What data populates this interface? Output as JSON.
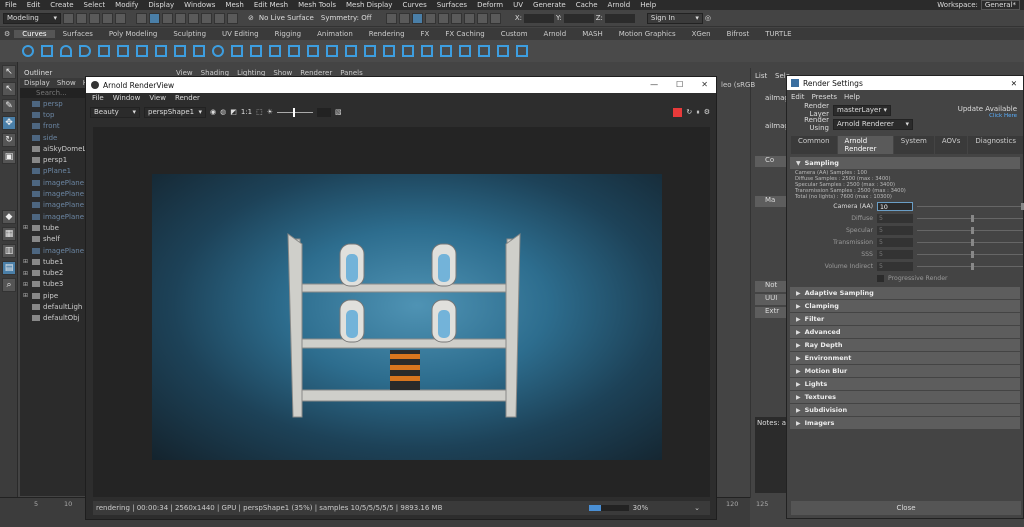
{
  "menubar": {
    "items": [
      "File",
      "Edit",
      "Create",
      "Select",
      "Modify",
      "Display",
      "Windows",
      "Mesh",
      "Edit Mesh",
      "Mesh Tools",
      "Mesh Display",
      "Curves",
      "Surfaces",
      "Deform",
      "UV",
      "Generate",
      "Cache",
      "Arnold",
      "Help"
    ],
    "workspace_label": "Workspace:",
    "workspace_value": "General*"
  },
  "status_line": {
    "mode": "Modeling",
    "live_surface": "No Live Surface",
    "symmetry": "Symmetry: Off",
    "x_label": "X:",
    "y_label": "Y:",
    "z_label": "Z:",
    "sign_in": "Sign In"
  },
  "shelf_tabs": [
    "Curves",
    "Surfaces",
    "Poly Modeling",
    "Sculpting",
    "UV Editing",
    "Rigging",
    "Animation",
    "Rendering",
    "FX",
    "FX Caching",
    "Custom",
    "Arnold",
    "MASH",
    "Motion Graphics",
    "XGen",
    "Bifrost",
    "TURTLE"
  ],
  "outliner": {
    "title": "Outliner",
    "menu": [
      "Display",
      "Show",
      "H"
    ],
    "search_placeholder": "Search...",
    "items": [
      {
        "label": "persp",
        "dim": true,
        "exp": ""
      },
      {
        "label": "top",
        "dim": true,
        "exp": ""
      },
      {
        "label": "front",
        "dim": true,
        "exp": ""
      },
      {
        "label": "side",
        "dim": true,
        "exp": ""
      },
      {
        "label": "aiSkyDomeL",
        "dim": false,
        "exp": ""
      },
      {
        "label": "persp1",
        "dim": false,
        "exp": ""
      },
      {
        "label": "pPlane1",
        "dim": true,
        "exp": ""
      },
      {
        "label": "imagePlane",
        "dim": true,
        "exp": ""
      },
      {
        "label": "imagePlane",
        "dim": true,
        "exp": ""
      },
      {
        "label": "imagePlane",
        "dim": true,
        "exp": ""
      },
      {
        "label": "imagePlane",
        "dim": true,
        "exp": ""
      },
      {
        "label": "tube",
        "dim": false,
        "exp": "+"
      },
      {
        "label": "shelf",
        "dim": false,
        "exp": ""
      },
      {
        "label": "imagePlane",
        "dim": true,
        "exp": ""
      },
      {
        "label": "tube1",
        "dim": false,
        "exp": "+"
      },
      {
        "label": "tube2",
        "dim": false,
        "exp": "+"
      },
      {
        "label": "tube3",
        "dim": false,
        "exp": "+"
      },
      {
        "label": "pipe",
        "dim": false,
        "exp": "+"
      },
      {
        "label": "defaultLigh",
        "dim": false,
        "exp": ""
      },
      {
        "label": "defaultObj",
        "dim": false,
        "exp": ""
      }
    ]
  },
  "viewport_menu": [
    "View",
    "Shading",
    "Lighting",
    "Show",
    "Renderer",
    "Panels"
  ],
  "renderview": {
    "title": "Arnold RenderView",
    "menu": [
      "File",
      "Window",
      "View",
      "Render"
    ],
    "aov": "Beauty",
    "camera": "perspShape1",
    "ratio": "1:1",
    "status": "rendering | 00:00:34 | 2560x1440 | GPU | perspShape1 (35%) | samples 10/5/5/5/5/5 | 9893.16 MB",
    "progress_text": "30%",
    "progress": 0.3
  },
  "attr_editor": {
    "tabs": [
      "List",
      "Sele"
    ],
    "fields": [
      "aiImagerl",
      "aiImag"
    ],
    "labels": [
      "Co",
      "Ma",
      "Not",
      "UUI",
      "Extr"
    ],
    "notes": "Notes: ai",
    "extra": "leo (sRGB"
  },
  "render_settings": {
    "title": "Render Settings",
    "menu": [
      "Edit",
      "Presets",
      "Help"
    ],
    "render_layer_label": "Render Layer",
    "render_layer": "masterLayer",
    "render_using_label": "Render Using",
    "render_using": "Arnold Renderer",
    "update_available": "Update Available",
    "click_here": "Click Here",
    "tabs": [
      "Common",
      "Arnold Renderer",
      "System",
      "AOVs",
      "Diagnostics"
    ],
    "sampling_section": "Sampling",
    "sampling_info": [
      "Camera (AA) Samples : 100",
      "Diffuse Samples : 2500 (max : 3400)",
      "Specular Samples : 2500 (max : 3400)",
      "Transmission Samples : 2500 (max : 3400)",
      "Total (no lights) : 7600 (max : 10300)"
    ],
    "fields": [
      {
        "label": "Camera (AA)",
        "value": "10",
        "active": true
      },
      {
        "label": "Diffuse",
        "value": "5",
        "active": false
      },
      {
        "label": "Specular",
        "value": "5",
        "active": false
      },
      {
        "label": "Transmission",
        "value": "5",
        "active": false
      },
      {
        "label": "SSS",
        "value": "5",
        "active": false
      },
      {
        "label": "Volume Indirect",
        "value": "5",
        "active": false
      }
    ],
    "progressive_label": "Progressive Render",
    "sections": [
      "Adaptive Sampling",
      "Clamping",
      "Filter",
      "Advanced",
      "Ray Depth",
      "Environment",
      "Motion Blur",
      "Lights",
      "Textures",
      "Subdivision",
      "Imagers"
    ],
    "close": "Close"
  },
  "timeline": {
    "ticks": [
      "5",
      "10",
      "120",
      "125"
    ]
  }
}
